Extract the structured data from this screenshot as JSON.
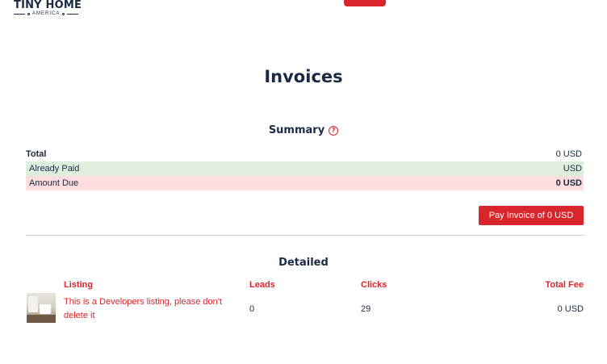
{
  "header": {
    "logo_title": "TINY HOME",
    "logo_subtitle": "AMERICA"
  },
  "page": {
    "title": "Invoices"
  },
  "summary": {
    "heading": "Summary",
    "help_icon_glyph": "?",
    "rows": {
      "total": {
        "label": "Total",
        "value": "0 USD"
      },
      "paid": {
        "label": "Already Paid",
        "value": "USD"
      },
      "due": {
        "label": "Amount Due",
        "value": "0 USD"
      }
    },
    "pay_button_label": "Pay Invoice of 0 USD"
  },
  "detailed": {
    "heading": "Detailed",
    "columns": {
      "listing": "Listing",
      "leads": "Leads",
      "clicks": "Clicks",
      "fee": "Total Fee"
    },
    "rows": [
      {
        "listing": "This is a Developers listing, please don't delete it",
        "leads": "0",
        "clicks": "29",
        "fee": "0 USD"
      }
    ]
  },
  "colors": {
    "accent": "#d9262c",
    "navy": "#1b2a44",
    "paid_bg": "#dfeedd",
    "due_bg": "#fbdedd"
  }
}
